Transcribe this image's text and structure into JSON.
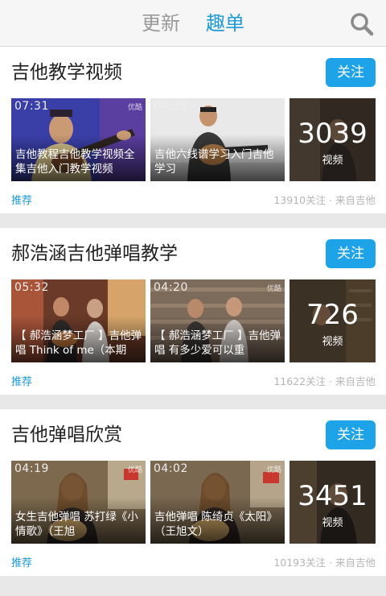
{
  "header": {
    "tabs": [
      {
        "label": "更新",
        "active": false
      },
      {
        "label": "趣单",
        "active": true
      }
    ],
    "search_icon": "search-icon",
    "accent_color": "#1e9ad6"
  },
  "cards": [
    {
      "title": "吉他教学视频",
      "follow_label": "关注",
      "videos": [
        {
          "duration": "07:31",
          "title": "吉他教程吉他教学视频全集吉他入门教学视频",
          "watermark": "优酷"
        },
        {
          "duration": "04:32",
          "title": "吉他六线谱学习入门吉他学习",
          "watermark": ""
        }
      ],
      "more": {
        "count": "3039",
        "label": "视频"
      },
      "recommend": "推荐",
      "meta": "13910关注 · 来自吉他"
    },
    {
      "title": "郝浩涵吉他弹唱教学",
      "follow_label": "关注",
      "videos": [
        {
          "duration": "05:32",
          "title": "【 郝浩涵梦工厂 】吉他弹唱 Think of me（本期",
          "watermark": ""
        },
        {
          "duration": "04:20",
          "title": "【 郝浩涵梦工厂 】吉他弹唱 有多少爱可以重",
          "watermark": "优酷"
        }
      ],
      "more": {
        "count": "726",
        "label": "视频"
      },
      "recommend": "推荐",
      "meta": "11622关注 · 来自吉他"
    },
    {
      "title": "吉他弹唱欣赏",
      "follow_label": "关注",
      "videos": [
        {
          "duration": "04:19",
          "title": "女生吉他弹唱 苏打绿《小情歌》（王旭",
          "watermark": "优酷"
        },
        {
          "duration": "04:02",
          "title": "吉他弹唱 陈绮贞《太阳》（王旭文）",
          "watermark": "优酷"
        }
      ],
      "more": {
        "count": "3451",
        "label": "视频"
      },
      "recommend": "推荐",
      "meta": "10193关注 · 来自吉他"
    }
  ]
}
